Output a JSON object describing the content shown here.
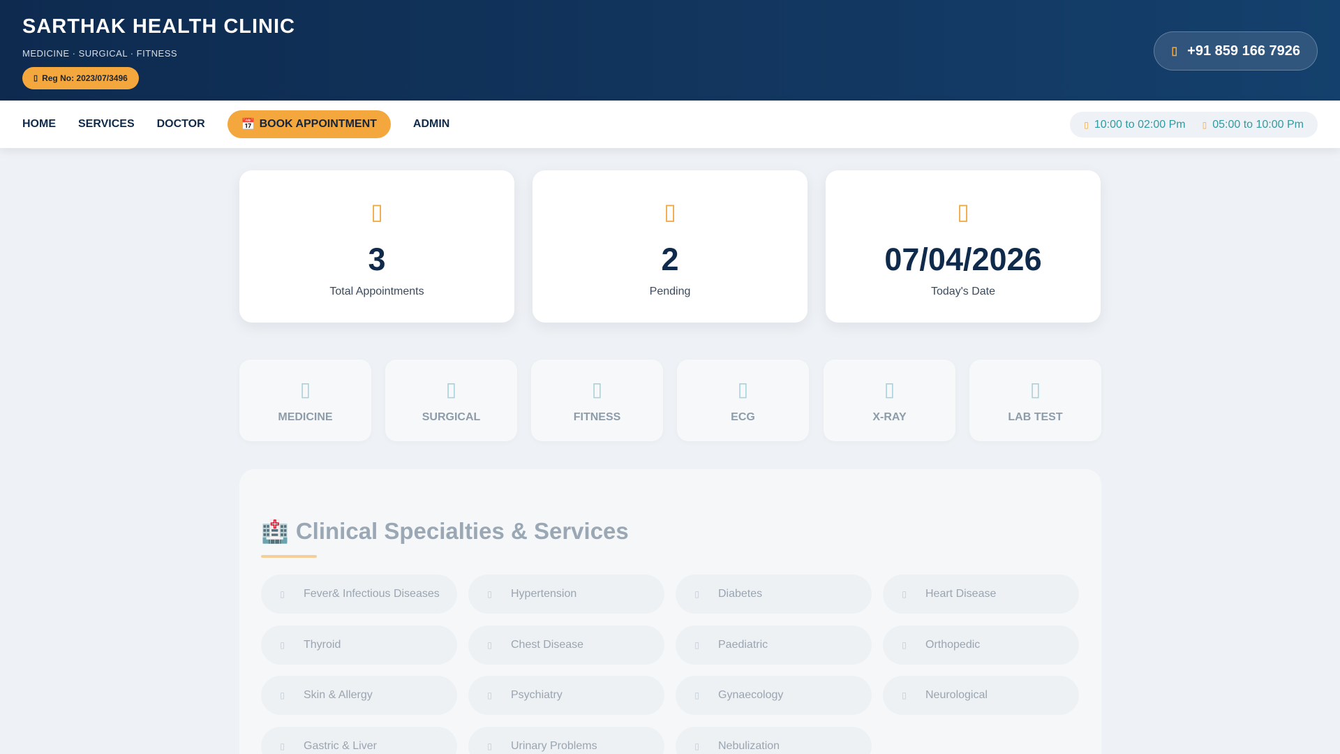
{
  "header": {
    "title": "SARTHAK HEALTH CLINIC",
    "subtitle": "MEDICINE · SURGICAL · FITNESS",
    "reg_badge": "Reg No: 2023/07/3496",
    "phone": "+91 859 166 7926",
    "reg_icon": "certificate-icon",
    "phone_icon": "phone-icon"
  },
  "nav": {
    "items": [
      "HOME",
      "SERVICES",
      "DOCTOR",
      "BOOK APPOINTMENT",
      "ADMIN"
    ],
    "cta_icon": "📅",
    "hours": [
      "10:00 to 02:00 Pm",
      "05:00 to 10:00 Pm"
    ],
    "hours_icon": "clock-icon"
  },
  "stats": [
    {
      "value": "3",
      "label": "Total Appointments",
      "icon": "calendar-check-icon"
    },
    {
      "value": "2",
      "label": "Pending",
      "icon": "hourglass-icon"
    },
    {
      "value": "07/04/2026",
      "label": "Today's Date",
      "icon": "calendar-day-icon"
    }
  ],
  "services": [
    {
      "label": "MEDICINE",
      "icon": "pills-icon"
    },
    {
      "label": "SURGICAL",
      "icon": "scalpel-icon"
    },
    {
      "label": "FITNESS",
      "icon": "dumbbell-icon"
    },
    {
      "label": "ECG",
      "icon": "heartbeat-icon"
    },
    {
      "label": "X-RAY",
      "icon": "x-ray-icon"
    },
    {
      "label": "LAB TEST",
      "icon": "flask-icon"
    }
  ],
  "specialties": {
    "title": "Clinical Specialties & Services",
    "title_icon": "🏥",
    "items": [
      "Fever& Infectious Diseases",
      "Hypertension",
      "Diabetes",
      "Heart Disease",
      "Thyroid",
      "Chest Disease",
      "Paediatric",
      "Orthopedic",
      "Skin & Allergy",
      "Psychiatry",
      "Gynaecology",
      "Neurological",
      "Gastric & Liver",
      "Urinary Problems",
      "Nebulization"
    ]
  },
  "colors": {
    "brand_dark": "#0e2a4f",
    "accent": "#f3a73c",
    "teal": "#2f9aa0"
  }
}
